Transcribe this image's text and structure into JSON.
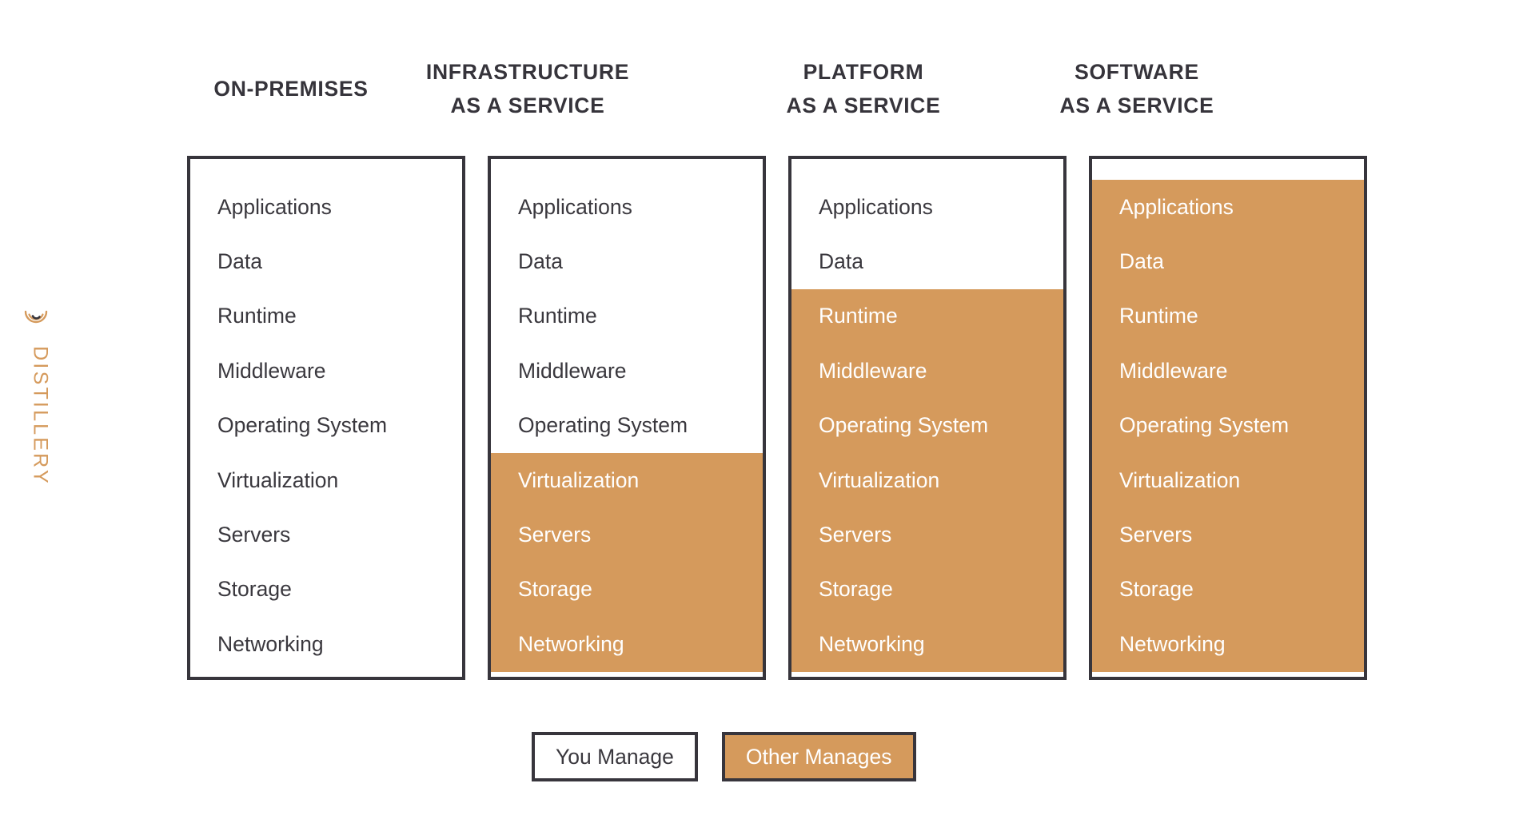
{
  "brand": {
    "name": "DISTILLERY",
    "mark_icon": "distillery-arc-logo-icon",
    "color": "#D59A5C"
  },
  "theme": {
    "managed_color": "#D59A5C",
    "border_color": "#37353C",
    "text_color": "#3A383E",
    "heading_color": "#36343B",
    "background": "#FFFFFF"
  },
  "diagram": {
    "layer_names": [
      "Applications",
      "Data",
      "Runtime",
      "Middleware",
      "Operating System",
      "Virtualization",
      "Servers",
      "Storage",
      "Networking"
    ],
    "columns": [
      {
        "title_line1": "ON-PREMISES",
        "title_line2": "",
        "managed_from_index": 9,
        "layers": [
          {
            "label": "Applications",
            "managed_by": "you"
          },
          {
            "label": "Data",
            "managed_by": "you"
          },
          {
            "label": "Runtime",
            "managed_by": "you"
          },
          {
            "label": "Middleware",
            "managed_by": "you"
          },
          {
            "label": "Operating System",
            "managed_by": "you"
          },
          {
            "label": "Virtualization",
            "managed_by": "you"
          },
          {
            "label": "Servers",
            "managed_by": "you"
          },
          {
            "label": "Storage",
            "managed_by": "you"
          },
          {
            "label": "Networking",
            "managed_by": "you"
          }
        ]
      },
      {
        "title_line1": "INFRASTRUCTURE",
        "title_line2": "AS A SERVICE",
        "managed_from_index": 5,
        "layers": [
          {
            "label": "Applications",
            "managed_by": "you"
          },
          {
            "label": "Data",
            "managed_by": "you"
          },
          {
            "label": "Runtime",
            "managed_by": "you"
          },
          {
            "label": "Middleware",
            "managed_by": "you"
          },
          {
            "label": "Operating System",
            "managed_by": "you"
          },
          {
            "label": "Virtualization",
            "managed_by": "other"
          },
          {
            "label": "Servers",
            "managed_by": "other"
          },
          {
            "label": "Storage",
            "managed_by": "other"
          },
          {
            "label": "Networking",
            "managed_by": "other"
          }
        ]
      },
      {
        "title_line1": "PLATFORM",
        "title_line2": "AS A SERVICE",
        "managed_from_index": 2,
        "layers": [
          {
            "label": "Applications",
            "managed_by": "you"
          },
          {
            "label": "Data",
            "managed_by": "you"
          },
          {
            "label": "Runtime",
            "managed_by": "other"
          },
          {
            "label": "Middleware",
            "managed_by": "other"
          },
          {
            "label": "Operating System",
            "managed_by": "other"
          },
          {
            "label": "Virtualization",
            "managed_by": "other"
          },
          {
            "label": "Servers",
            "managed_by": "other"
          },
          {
            "label": "Storage",
            "managed_by": "other"
          },
          {
            "label": "Networking",
            "managed_by": "other"
          }
        ]
      },
      {
        "title_line1": "SOFTWARE",
        "title_line2": "AS A SERVICE",
        "managed_from_index": 0,
        "layers": [
          {
            "label": "Applications",
            "managed_by": "other"
          },
          {
            "label": "Data",
            "managed_by": "other"
          },
          {
            "label": "Runtime",
            "managed_by": "other"
          },
          {
            "label": "Middleware",
            "managed_by": "other"
          },
          {
            "label": "Operating System",
            "managed_by": "other"
          },
          {
            "label": "Virtualization",
            "managed_by": "other"
          },
          {
            "label": "Servers",
            "managed_by": "other"
          },
          {
            "label": "Storage",
            "managed_by": "other"
          },
          {
            "label": "Networking",
            "managed_by": "other"
          }
        ]
      }
    ]
  },
  "legend": {
    "items": [
      {
        "label": "You Manage",
        "style": "you"
      },
      {
        "label": "Other Manages",
        "style": "other"
      }
    ]
  }
}
